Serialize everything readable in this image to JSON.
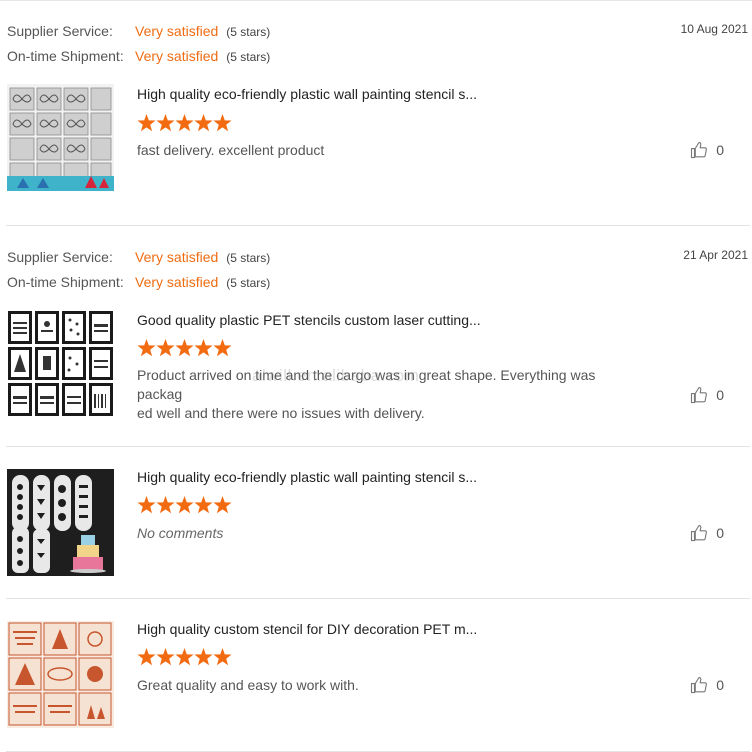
{
  "reviews": [
    {
      "supplier_label": "Supplier Service:",
      "supplier_value": "Very satisfied",
      "supplier_stars": "(5 stars)",
      "shipment_label": "On-time Shipment:",
      "shipment_value": "Very satisfied",
      "shipment_stars": "(5 stars)",
      "date": "10 Aug 2021",
      "product_title": "High quality eco-friendly plastic wall painting stencil s...",
      "rating": 5,
      "comment": "fast delivery. excellent product",
      "likes": "0",
      "thumbnail_icon": "butterfly-stencil-thumbnail"
    },
    {
      "supplier_label": "Supplier Service:",
      "supplier_value": "Very satisfied",
      "supplier_stars": "(5 stars)",
      "shipment_label": "On-time Shipment:",
      "shipment_value": "Very satisfied",
      "shipment_stars": "(5 stars)",
      "date": "21 Apr 2021",
      "product_title": "Good quality plastic PET stencils custom laser cutting...",
      "rating": 5,
      "comment_line1": "Product arrived on time and the cargo was in great shape. Everything was packag",
      "comment_line2": "ed well and there were no issues with delivery.",
      "likes": "0",
      "thumbnail_icon": "christmas-stencil-thumbnail"
    },
    {
      "product_title": "High quality eco-friendly plastic wall painting stencil s...",
      "rating": 5,
      "comment": "No comments",
      "likes": "0",
      "thumbnail_icon": "cake-stencil-thumbnail"
    },
    {
      "product_title": "High quality custom stencil for DIY decoration PET m...",
      "rating": 5,
      "comment": "Great quality and easy to work with.",
      "likes": "0",
      "thumbnail_icon": "holiday-stencil-thumbnail"
    }
  ],
  "watermark": "alwill.en.alibaba.com",
  "colors": {
    "accent": "#ef6c12",
    "star": "#f36b10"
  },
  "icons": {
    "like": "thumbs-up-icon",
    "star": "star-icon"
  }
}
